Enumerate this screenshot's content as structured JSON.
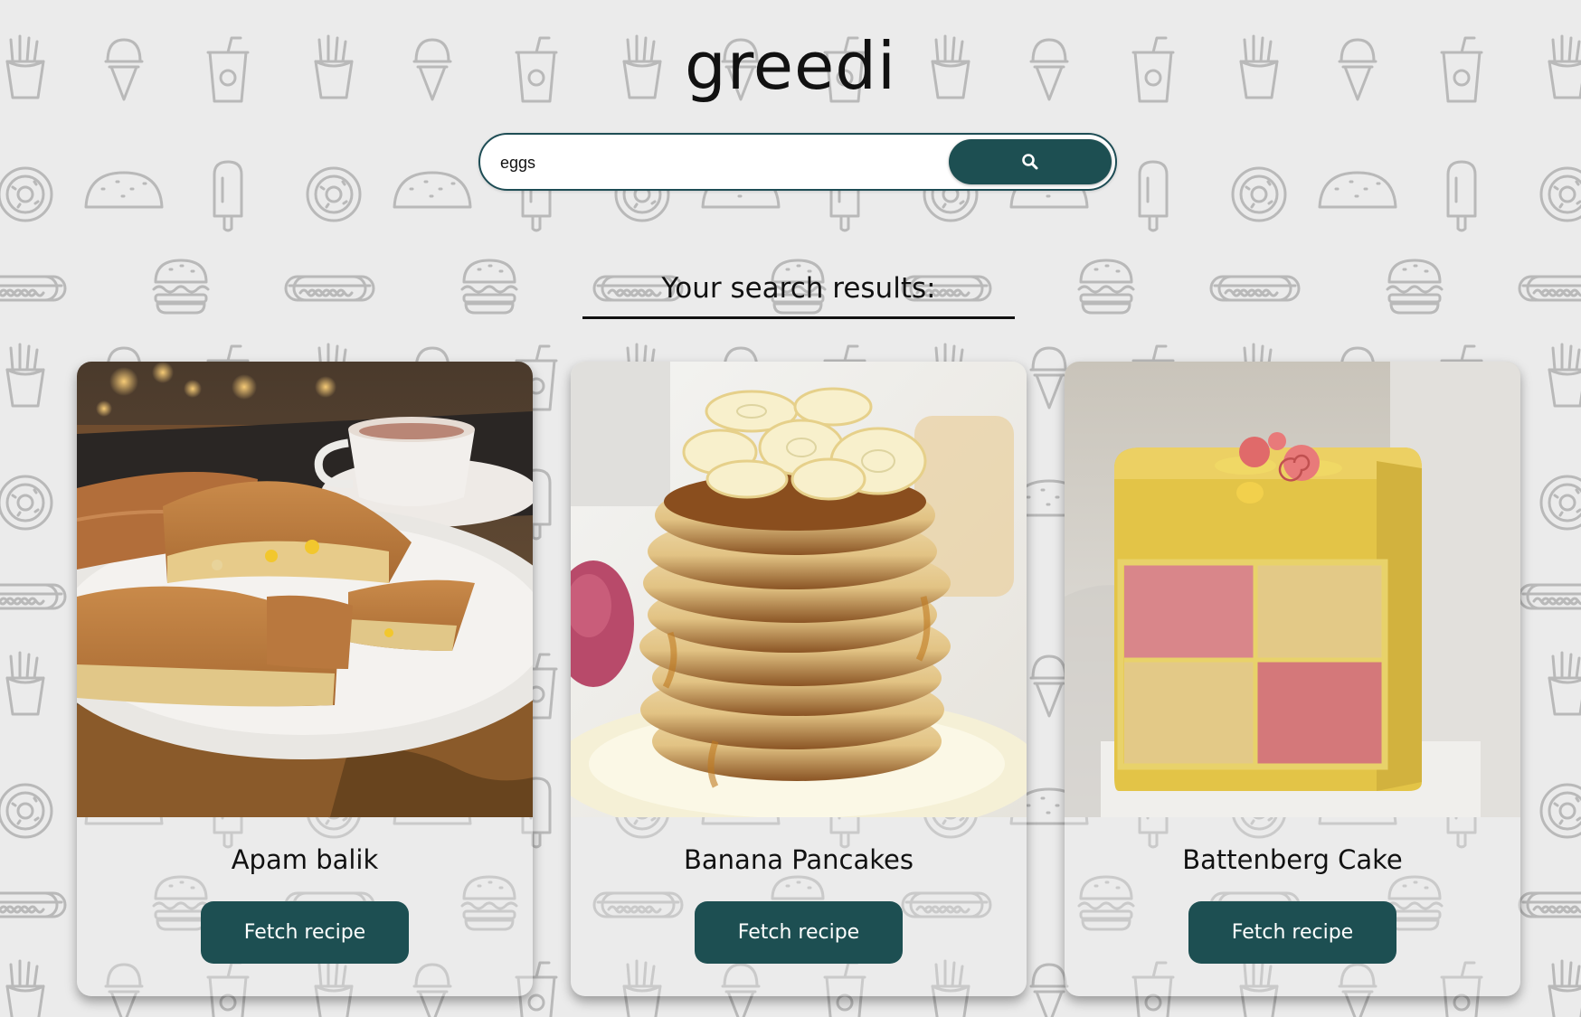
{
  "app": {
    "logo_text": "greedi"
  },
  "search": {
    "value": "eggs",
    "placeholder": "",
    "button_icon": "search-icon"
  },
  "results": {
    "heading": "Your search results:",
    "cards": [
      {
        "title": "Apam balik",
        "button_label": "Fetch recipe",
        "image": "apam-balik-photo"
      },
      {
        "title": "Banana Pancakes",
        "button_label": "Fetch recipe",
        "image": "banana-pancakes-photo"
      },
      {
        "title": "Battenberg Cake",
        "button_label": "Fetch recipe",
        "image": "battenberg-cake-photo"
      }
    ]
  },
  "colors": {
    "background": "#ebebeb",
    "accent": "#1d4f52",
    "pattern": "#b8b8b8",
    "text": "#111111"
  }
}
